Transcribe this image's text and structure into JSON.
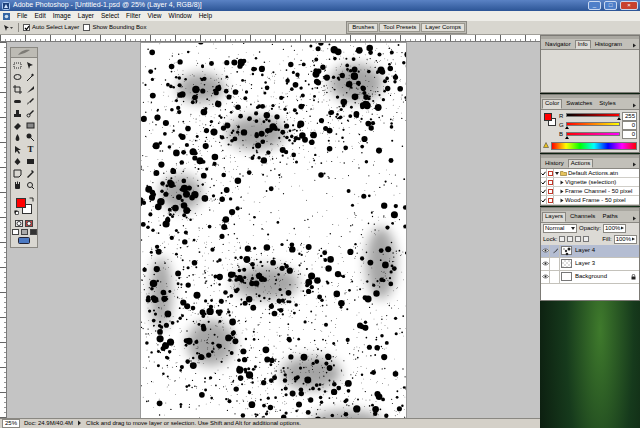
{
  "window": {
    "title": "Adobe Photoshop - [Untitled-1.psd @ 25% (Layer 4, RGB/8)]",
    "controls": [
      "_",
      "□",
      "×"
    ]
  },
  "menu": [
    "File",
    "Edit",
    "Image",
    "Layer",
    "Select",
    "Filter",
    "View",
    "Window",
    "Help"
  ],
  "options_bar": {
    "checkboxes": [
      {
        "label": "Auto Select Layer",
        "checked": true
      },
      {
        "label": "Show Bounding Box",
        "checked": false
      }
    ],
    "palette_well": [
      "Brushes",
      "Tool Presets",
      "Layer Comps"
    ]
  },
  "toolbox": {
    "type_tool_glyph": "T",
    "foreground_color": "#ff0000",
    "background_color": "#ffffff"
  },
  "navigator_panel": {
    "tabs": [
      {
        "label": "Navigator",
        "selected": false
      },
      {
        "label": "Info",
        "selected": true
      },
      {
        "label": "Histogram",
        "selected": false
      }
    ]
  },
  "color_panel": {
    "tabs": [
      {
        "label": "Color",
        "selected": true
      },
      {
        "label": "Swatches",
        "selected": false
      },
      {
        "label": "Styles",
        "selected": false
      }
    ],
    "channels": [
      {
        "name": "R",
        "value": "255",
        "level": 1
      },
      {
        "name": "G",
        "value": "0",
        "level": 0
      },
      {
        "name": "B",
        "value": "0",
        "level": 0
      }
    ]
  },
  "actions_panel": {
    "tabs": [
      {
        "label": "History",
        "selected": false
      },
      {
        "label": "Actions",
        "selected": true
      }
    ],
    "items": [
      {
        "name": "Default Actions.atn",
        "kind": "set",
        "checked": true,
        "expanded": true
      },
      {
        "name": "Vignette (selection)",
        "kind": "action",
        "checked": true,
        "expanded": false
      },
      {
        "name": "Frame Channel - 50 pixel",
        "kind": "action",
        "checked": true,
        "expanded": false
      },
      {
        "name": "Wood Frame - 50 pixel",
        "kind": "action",
        "checked": true,
        "expanded": false
      }
    ]
  },
  "layers_panel": {
    "tabs": [
      {
        "label": "Layers",
        "selected": true
      },
      {
        "label": "Channels",
        "selected": false
      },
      {
        "label": "Paths",
        "selected": false
      }
    ],
    "blend_mode": "Normal",
    "opacity_label": "Opacity:",
    "opacity": "100%",
    "lock_label": "Lock:",
    "fill_label": "Fill:",
    "fill": "100%",
    "layers": [
      {
        "name": "Layer 4",
        "selected": true,
        "visible": true,
        "locked": false
      },
      {
        "name": "Layer 3",
        "selected": false,
        "visible": true,
        "locked": false
      },
      {
        "name": "Background",
        "selected": false,
        "visible": true,
        "locked": true
      }
    ]
  },
  "status_bar": {
    "zoom": "25%",
    "document": "Doc: 24.9M/40.4M",
    "hint": "Click and drag to move layer or selection. Use Shift and Alt for additional options."
  }
}
